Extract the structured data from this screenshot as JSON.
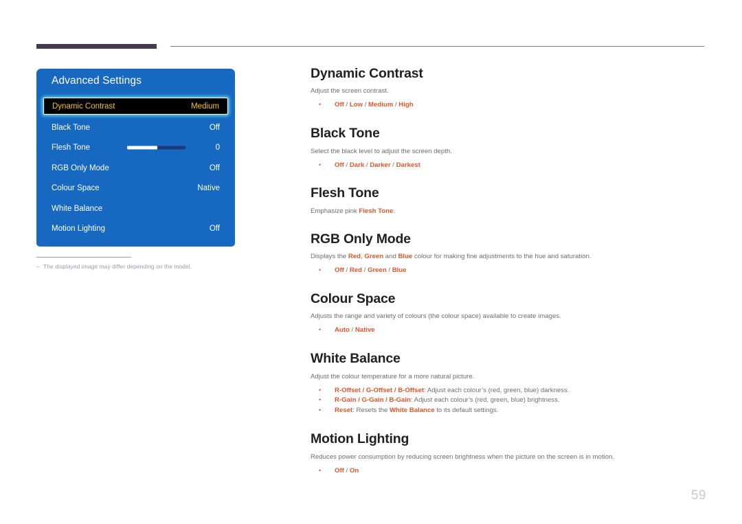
{
  "page": {
    "number": "59"
  },
  "osd": {
    "title": "Advanced Settings",
    "rows": [
      {
        "label": "Dynamic Contrast",
        "value": "Medium",
        "selected": true
      },
      {
        "label": "Black Tone",
        "value": "Off",
        "selected": false
      },
      {
        "label": "Flesh Tone",
        "value": "0",
        "selected": false,
        "slider": true
      },
      {
        "label": "RGB Only Mode",
        "value": "Off",
        "selected": false
      },
      {
        "label": "Colour Space",
        "value": "Native",
        "selected": false
      },
      {
        "label": "White Balance",
        "value": "",
        "selected": false
      },
      {
        "label": "Motion Lighting",
        "value": "Off",
        "selected": false
      }
    ]
  },
  "footnote": {
    "dash": "–",
    "text": "The displayed image may differ depending on the model."
  },
  "sections": {
    "dynamic_contrast": {
      "title": "Dynamic Contrast",
      "desc": "Adjust the screen contrast.",
      "bullet": {
        "o1": "Off",
        "s1": " / ",
        "o2": "Low",
        "s2": " / ",
        "o3": "Medium",
        "s3": " / ",
        "o4": "High"
      }
    },
    "black_tone": {
      "title": "Black Tone",
      "desc": "Select the black level to adjust the screen depth.",
      "bullet": {
        "o1": "Off",
        "s1": " / ",
        "o2": "Dark",
        "s2": " / ",
        "o3": "Darker",
        "s3": " / ",
        "o4": "Darkest"
      }
    },
    "flesh_tone": {
      "title": "Flesh Tone",
      "desc_pre": "Emphasize pink ",
      "desc_hl": "Flesh Tone",
      "desc_post": "."
    },
    "rgb_only_mode": {
      "title": "RGB Only Mode",
      "desc_pre": "Displays the ",
      "desc_red": "Red",
      "desc_mid1": ", ",
      "desc_green": "Green",
      "desc_mid2": " and ",
      "desc_blue": "Blue",
      "desc_post": " colour for making fine adjustments to the hue and saturation.",
      "bullet": {
        "o1": "Off",
        "s1": " / ",
        "o2": "Red",
        "s2": " / ",
        "o3": "Green",
        "s3": " / ",
        "o4": "Blue"
      }
    },
    "colour_space": {
      "title": "Colour Space",
      "desc": "Adjusts the range and variety of colours (the colour space) available to create images.",
      "bullet": {
        "o1": "Auto",
        "s1": " / ",
        "o2": "Native"
      }
    },
    "white_balance": {
      "title": "White Balance",
      "desc": "Adjust the colour temperature for a more natural picture.",
      "bullets": {
        "offset_hl": "R-Offset / G-Offset / B-Offset",
        "offset_text": ": Adjust each colour’s (red, green, blue) darkness.",
        "gain_hl": "R-Gain / G-Gain / B-Gain",
        "gain_text": ": Adjust each colour’s (red, green, blue) brightness.",
        "reset_hl": "Reset",
        "reset_text_pre": ": Resets the ",
        "reset_hl2": "White Balance",
        "reset_text_post": " to its default settings."
      }
    },
    "motion_lighting": {
      "title": "Motion Lighting",
      "desc": "Reduces power consumption by reducing screen brightness when the picture on the screen is in motion.",
      "bullet": {
        "o1": "Off",
        "s1": " / ",
        "o2": "On"
      }
    }
  }
}
